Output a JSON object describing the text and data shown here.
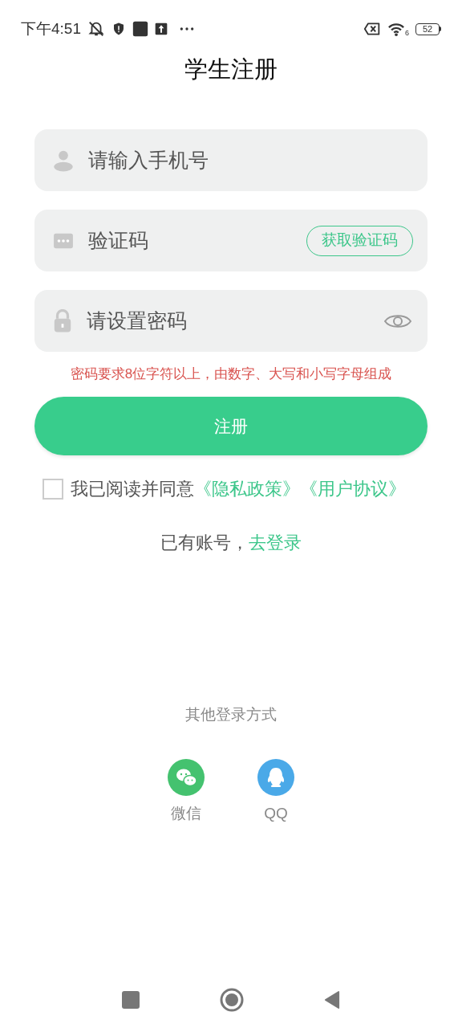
{
  "status_bar": {
    "time": "下午4:51",
    "wifi_label": "6",
    "battery": "52"
  },
  "title": "学生注册",
  "fields": [
    {
      "kind": "phone",
      "placeholder": "请输入手机号"
    },
    {
      "kind": "code",
      "placeholder": "验证码",
      "action": "获取验证码"
    },
    {
      "kind": "password",
      "placeholder": "请设置密码"
    }
  ],
  "password_hint": "密码要求8位字符以上，由数字、大写和小写字母组成",
  "submit": "注册",
  "agreement": {
    "checked": false,
    "label": "我已阅读并同意",
    "links": [
      "《隐私政策》",
      "《用户协议》"
    ]
  },
  "login": {
    "prompt": "已有账号，",
    "link": "去登录"
  },
  "other_login": {
    "title": "其他登录方式",
    "options": [
      {
        "kind": "wechat",
        "label": "微信"
      },
      {
        "kind": "qq",
        "label": "QQ"
      }
    ]
  }
}
